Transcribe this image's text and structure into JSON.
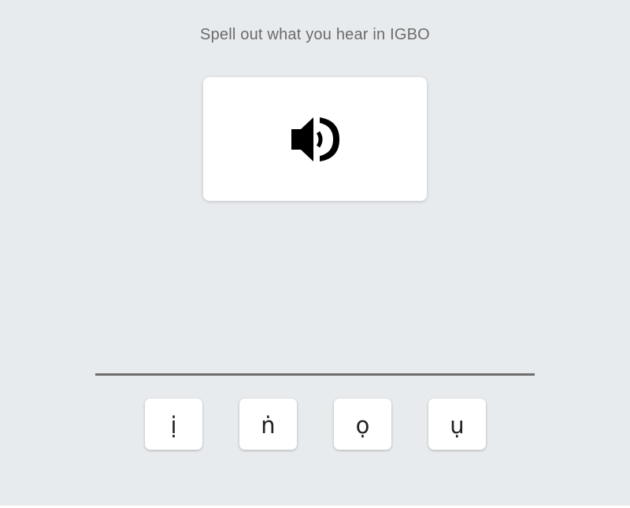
{
  "prompt": "Spell out what you hear in IGBO",
  "audio": {
    "icon": "speaker-volume-icon"
  },
  "keys": [
    {
      "label": "ị"
    },
    {
      "label": "ṅ"
    },
    {
      "label": "ọ"
    },
    {
      "label": "ụ"
    }
  ],
  "colors": {
    "background": "#e8ebee",
    "card": "#ffffff",
    "prompt_text": "#6b6b6b",
    "answer_line": "#6e6e6e",
    "icon": "#000000"
  }
}
